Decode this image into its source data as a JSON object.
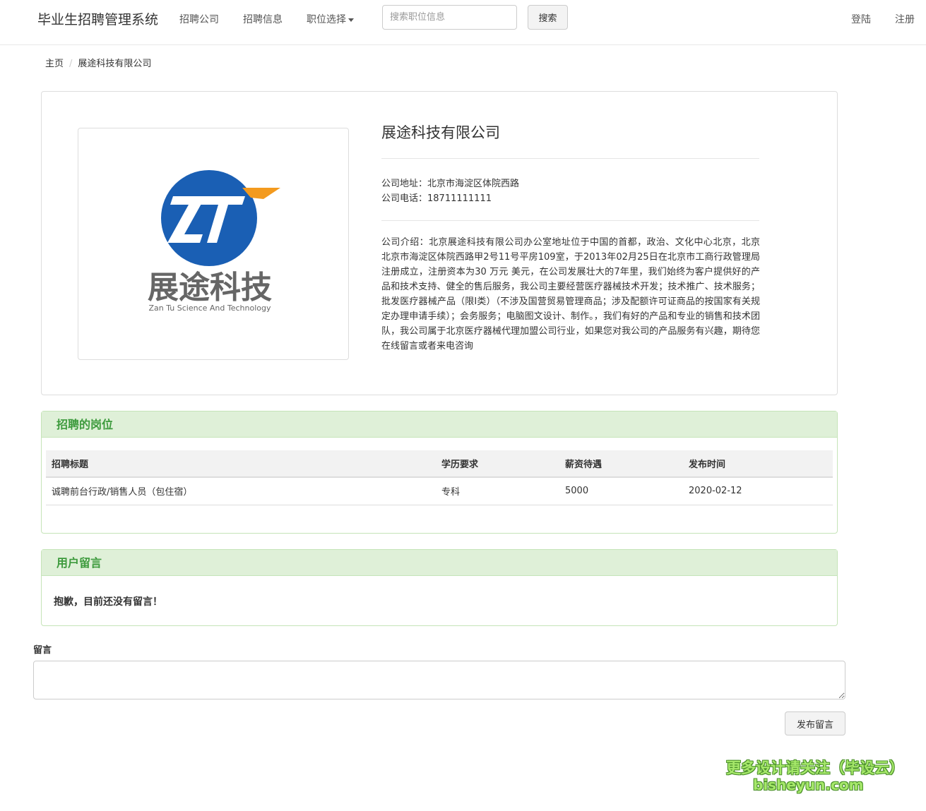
{
  "nav": {
    "brand": "毕业生招聘管理系统",
    "links": [
      "招聘公司",
      "招聘信息"
    ],
    "dropdown_label": "职位选择",
    "search_placeholder": "搜索职位信息",
    "search_button": "搜索",
    "login": "登陆",
    "register": "注册"
  },
  "breadcrumb": {
    "home": "主页",
    "current": "展途科技有限公司"
  },
  "company": {
    "name": "展途科技有限公司",
    "logo_text_cn": "展途科技",
    "logo_text_en": "Zan Tu Science And Technology",
    "address_label": "公司地址：",
    "address": "北京市海淀区体院西路",
    "phone_label": "公司电话：",
    "phone": "18711111111",
    "intro_label": "公司介绍：",
    "intro": "北京展途科技有限公司办公室地址位于中国的首都，政治、文化中心北京，北京 北京市海淀区体院西路甲2号11号平房109室，于2013年02月25日在北京市工商行政管理局注册成立，注册资本为30 万元 美元，在公司发展壮大的7年里，我们始终为客户提供好的产品和技术支持、健全的售后服务，我公司主要经营医疗器械技术开发；技术推广、技术服务；批发医疗器械产品（限Ⅰ类）（不涉及国营贸易管理商品；涉及配额许可证商品的按国家有关规定办理申请手续）；会务服务；电脑图文设计、制作。，我们有好的产品和专业的销售和技术团队，我公司属于北京医疗器械代理加盟公司行业，如果您对我公司的产品服务有兴趣，期待您在线留言或者来电咨询"
  },
  "jobs": {
    "title": "招聘的岗位",
    "headers": [
      "招聘标题",
      "学历要求",
      "薪资待遇",
      "发布时间"
    ],
    "rows": [
      [
        "诚聘前台行政/销售人员（包住宿）",
        "专科",
        "5000",
        "2020-02-12"
      ]
    ]
  },
  "messages": {
    "title": "用户留言",
    "empty": "抱歉，目前还没有留言！"
  },
  "form": {
    "label": "留言",
    "textarea_value": "",
    "submit": "发布留言"
  },
  "watermark": {
    "line1": "更多设计请关注（毕设云）",
    "line2": "bisheyun.com"
  },
  "colors": {
    "logo_blue": "#1a5fb4",
    "logo_orange": "#f39a1e",
    "panel_green_bg": "#dff0d8",
    "panel_green_text": "#3c9a3c"
  }
}
